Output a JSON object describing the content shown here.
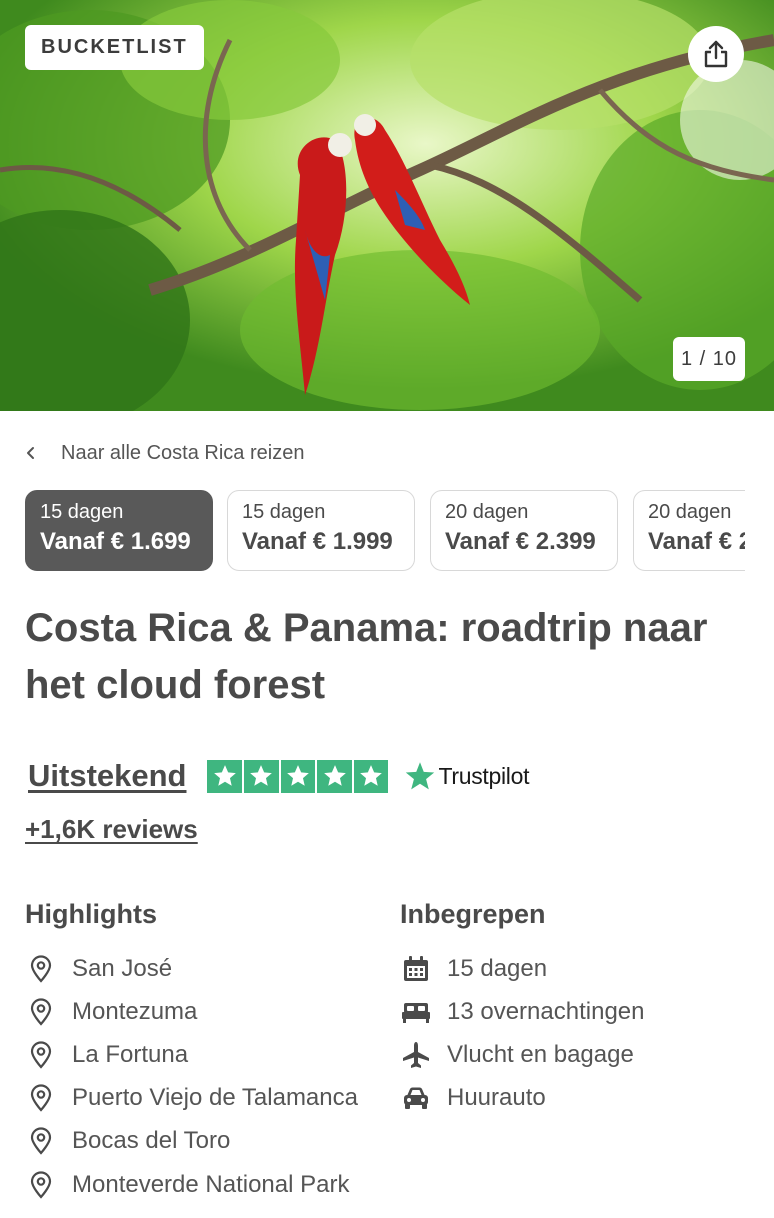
{
  "hero": {
    "badge": "BUCKETLIST",
    "counter": "1 / 10",
    "share_icon": "share-icon"
  },
  "back_link": {
    "label": "Naar alle Costa Rica reizen",
    "icon": "chevron-left-icon"
  },
  "options": [
    {
      "days": "15 dagen",
      "price": "Vanaf € 1.699",
      "selected": true
    },
    {
      "days": "15 dagen",
      "price": "Vanaf € 1.999",
      "selected": false
    },
    {
      "days": "20 dagen",
      "price": "Vanaf € 2.399",
      "selected": false
    },
    {
      "days": "20 dagen",
      "price": "Vanaf € 2",
      "selected": false
    }
  ],
  "title": "Costa Rica & Panama: roadtrip naar het cloud forest",
  "rating": {
    "label": "Uitstekend",
    "stars": 5,
    "provider": "Trustpilot",
    "reviews": "+1,6K reviews",
    "star_color": "#3fb680"
  },
  "highlights": {
    "heading": "Highlights",
    "icon": "map-pin-icon",
    "items": [
      "San José",
      "Montezuma",
      "La Fortuna",
      "Puerto Viejo de Talamanca",
      "Bocas del Toro",
      "Monteverde National Park"
    ]
  },
  "included": {
    "heading": "Inbegrepen",
    "items": [
      {
        "label": "15 dagen",
        "icon": "calendar-icon"
      },
      {
        "label": "13 overnachtingen",
        "icon": "bed-icon"
      },
      {
        "label": "Vlucht en bagage",
        "icon": "airplane-icon"
      },
      {
        "label": "Huurauto",
        "icon": "car-icon"
      }
    ]
  }
}
